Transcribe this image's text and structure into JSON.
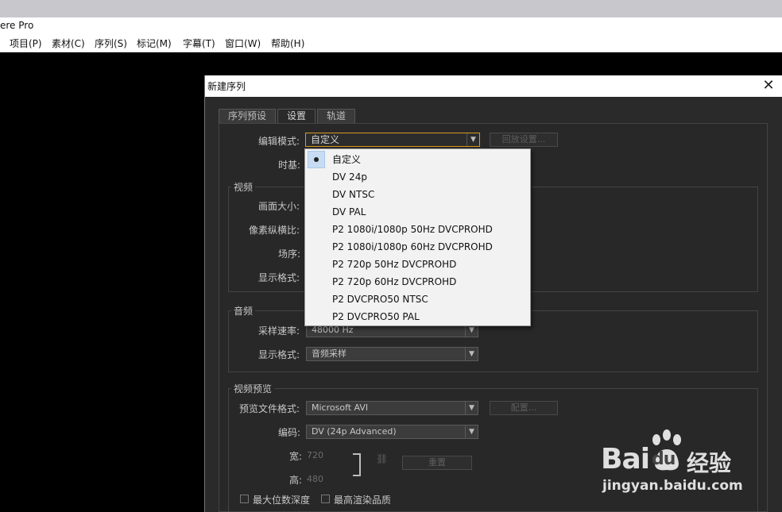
{
  "app": {
    "title_partial": "ere Pro"
  },
  "menu": [
    "项目(P)",
    "素材(C)",
    "序列(S)",
    "标记(M)",
    "字幕(T)",
    "窗口(W)",
    "帮助(H)"
  ],
  "dialog": {
    "title": "新建序列",
    "tabs": [
      "序列预设",
      "设置",
      "轨道"
    ],
    "edit_mode_label": "编辑模式:",
    "edit_mode_value": "自定义",
    "playback_button": "回放设置...",
    "timebase_label": "时基:",
    "video": {
      "title": "视频",
      "frame_size_label": "画面大小:",
      "pixel_aspect_label": "像素纵横比:",
      "field_order_label": "场序:",
      "display_format_label": "显示格式:"
    },
    "audio": {
      "title": "音频",
      "sample_rate_label": "采样速率:",
      "sample_rate_value": "48000 Hz",
      "display_format_label": "显示格式:",
      "display_format_value": "音频采样"
    },
    "preview": {
      "title": "视频预览",
      "file_format_label": "预览文件格式:",
      "file_format_value": "Microsoft AVI",
      "config_button": "配置...",
      "codec_label": "编码:",
      "codec_value": "DV (24p Advanced)",
      "width_label": "宽:",
      "width_value": "720",
      "height_label": "高:",
      "height_value": "480",
      "reset_button": "重置",
      "max_depth_label": "最大位数深度",
      "max_quality_label": "最高渲染品质"
    }
  },
  "dropdown": {
    "options": [
      "自定义",
      "DV 24p",
      "DV NTSC",
      "DV PAL",
      "P2 1080i/1080p 50Hz DVCPROHD",
      "P2 1080i/1080p 60Hz DVCPROHD",
      "P2 720p 50Hz DVCPROHD",
      "P2 720p 60Hz DVCPROHD",
      "P2 DVCPRO50 NTSC",
      "P2 DVCPRO50 PAL"
    ],
    "selected_index": 0
  },
  "watermark": {
    "brand": "Bai",
    "brand2": "du",
    "cn": "经验",
    "url": "jingyan.baidu.com"
  }
}
